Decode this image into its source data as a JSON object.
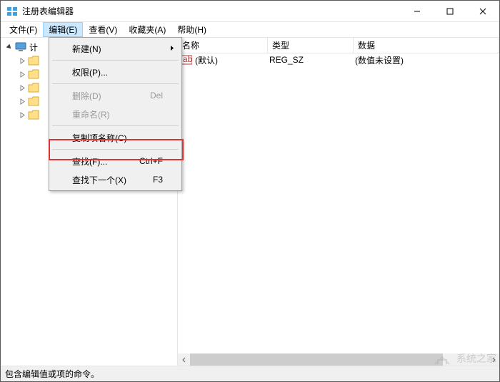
{
  "window": {
    "title": "注册表编辑器"
  },
  "menubar": {
    "file": "文件(F)",
    "edit": "编辑(E)",
    "view": "查看(V)",
    "favorites": "收藏夹(A)",
    "help": "帮助(H)"
  },
  "tree": {
    "root": "计",
    "items": [
      "",
      "",
      "",
      "",
      ""
    ]
  },
  "columns": {
    "name": "名称",
    "type": "类型",
    "data": "数据"
  },
  "rows": [
    {
      "name": "(默认)",
      "type": "REG_SZ",
      "data": "(数值未设置)"
    }
  ],
  "editMenu": {
    "new": "新建(N)",
    "permissions": "权限(P)...",
    "delete": "删除(D)",
    "deleteKey": "Del",
    "rename": "重命名(R)",
    "copyKeyName": "复制项名称(C)",
    "find": "查找(F)...",
    "findKey": "Ctrl+F",
    "findNext": "查找下一个(X)",
    "findNextKey": "F3"
  },
  "status": "包含编辑值或项的命令。",
  "watermark": "系统之家"
}
